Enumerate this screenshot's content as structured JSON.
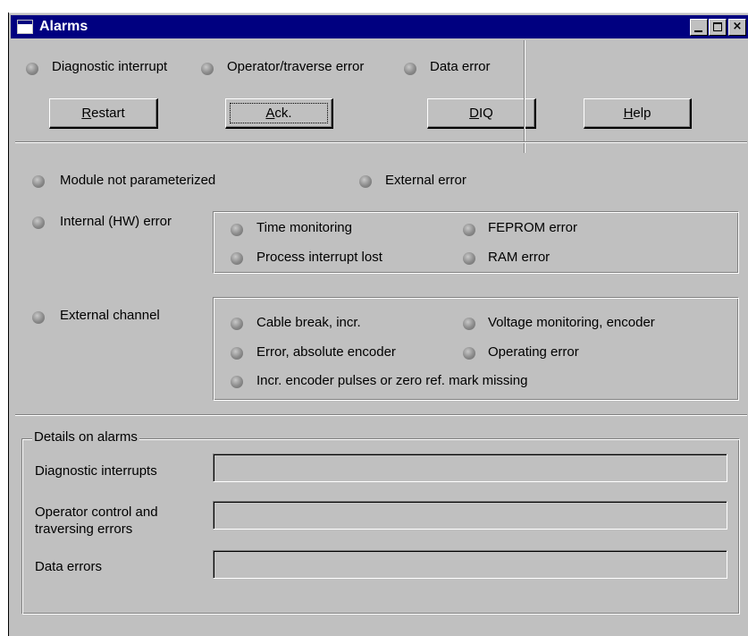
{
  "window": {
    "title": "Alarms",
    "controls": {
      "minimize": "_",
      "maximize": "□",
      "close": "×"
    }
  },
  "top_indicators": [
    {
      "label": "Diagnostic interrupt"
    },
    {
      "label": "Operator/traverse error"
    },
    {
      "label": "Data error"
    }
  ],
  "buttons": {
    "restart": {
      "mnemonic": "R",
      "rest": "estart"
    },
    "ack": {
      "mnemonic": "A",
      "rest": "ck."
    },
    "diq": {
      "mnemonic": "D",
      "rest": "IQ"
    },
    "help": {
      "mnemonic": "H",
      "rest": "elp"
    }
  },
  "status": {
    "module_not_parameterized": "Module not parameterized",
    "external_error": "External error",
    "internal_hw_error": "Internal (HW) error",
    "external_channel": "External channel"
  },
  "internal_group": {
    "time_monitoring": "Time monitoring",
    "feprom_error": "FEPROM error",
    "process_interrupt_lost": "Process interrupt lost",
    "ram_error": "RAM error"
  },
  "external_group": {
    "cable_break": "Cable break, incr.",
    "voltage_monitoring": "Voltage monitoring, encoder",
    "error_absolute_encoder": "Error, absolute encoder",
    "operating_error": "Operating error",
    "incr_encoder_pulses": "Incr. encoder pulses or zero ref. mark missing"
  },
  "details": {
    "legend": "Details on alarms",
    "diagnostic_interrupts": {
      "label": "Diagnostic interrupts",
      "value": ""
    },
    "operator_errors": {
      "label_line1": "Operator control and",
      "label_line2": "traversing errors",
      "value": ""
    },
    "data_errors": {
      "label": "Data errors",
      "value": ""
    }
  },
  "colors": {
    "titlebar": "#000080",
    "face": "#c0c0c0",
    "led_off": "#8a8a8a"
  }
}
